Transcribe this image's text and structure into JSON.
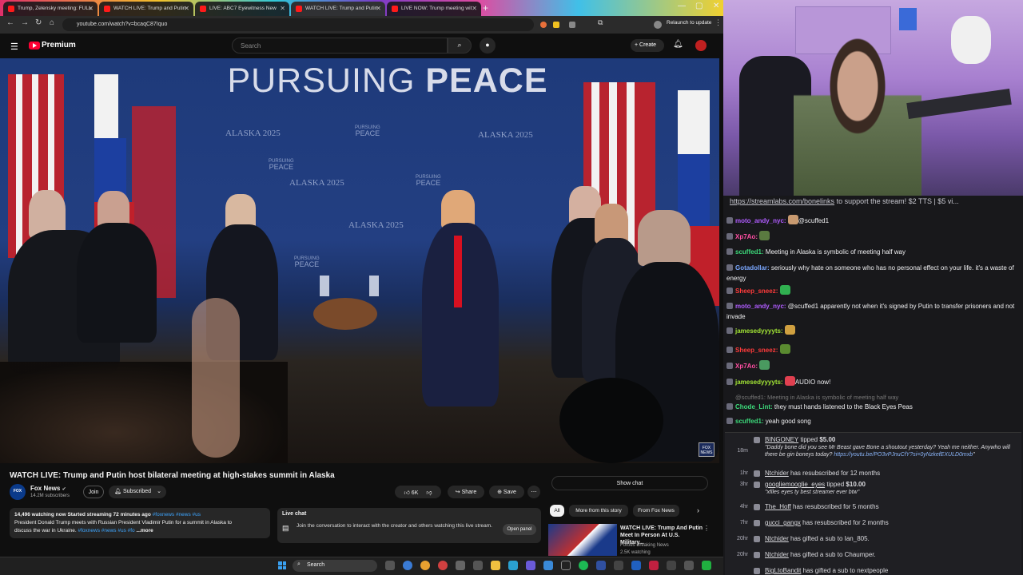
{
  "browser": {
    "tabs": [
      "Trump, Zelensky meeting: FULL",
      "WATCH LIVE: Trump and Putin",
      "LIVE: ABC7 Eyewitness New",
      "WATCH LIVE: Trump and Putin",
      "LIVE NOW: Trump meeting wit"
    ],
    "url": "youtube.com/watch?v=bcaqC87Iquo",
    "relaunch": "Relaunch to update"
  },
  "yt": {
    "logo": "Premium",
    "search_placeholder": "Search",
    "create": "Create"
  },
  "video": {
    "banner_light": "PURSUING ",
    "banner_bold": "PEACE",
    "back_text": "ALASKA 2025",
    "back_pursuing": "PURSUING",
    "back_peace": "PEACE",
    "bug": "FOX NEWS"
  },
  "info": {
    "title": "WATCH LIVE: Trump and Putin host bilateral meeting at high-stakes summit in Alaska",
    "channel": "Fox News",
    "subscribers": "14.2M subscribers",
    "join": "Join",
    "subscribed": "Subscribed",
    "likes": "6K",
    "share": "Share",
    "save": "Save",
    "desc_stats": "14,496 watching now  Started streaming 72 minutes ago",
    "desc_stat_tags": "#foxnews #news #us",
    "desc_line2": "President Donald Trump meets with Russian President Vladimir Putin for a summit in Alaska to",
    "desc_line3": "discuss the war in Ukraine.",
    "desc_line3_tags": "#foxnews #news #us #fo",
    "more": "...more",
    "live_chat_label": "Live chat",
    "live_chat_msg": "Join the conversation to interact with the creator and others watching this live stream.",
    "open_panel": "Open panel",
    "show_chat": "Show chat",
    "chips": [
      "All",
      "More from this story",
      "From Fox News"
    ],
    "rec_title": "WATCH LIVE: Trump And Putin Meet In Person At U.S. Military...",
    "rec_channel": "Forbes Breaking News",
    "rec_views": "2.5K watching"
  },
  "taskbar": {
    "search": "Search"
  },
  "stream_chat": {
    "pinned_link": "https://streamlabs.com/bonelinks",
    "pinned_rest": " to support the stream! $2 TTS | $5 vi...",
    "messages": [
      {
        "user": "moto_andy_nyc:",
        "color": "#b05cff",
        "text": "@scuffed1"
      },
      {
        "user": "Xp7Ao:",
        "color": "#ff4fa3",
        "text": ""
      },
      {
        "user": "scuffed1:",
        "color": "#3cd97a",
        "text": "Meeting in Alaska is symbolic of meeting half way"
      },
      {
        "user": "Gotadollar:",
        "color": "#7aa7ff",
        "text": "seriously why hate on someone who has no personal effect on your life. it's a waste of energy"
      },
      {
        "user": "Sheep_sneez:",
        "color": "#ff3b3b",
        "text": ""
      },
      {
        "user": "moto_andy_nyc:",
        "color": "#b05cff",
        "text": "@scuffed1 apparently not when it's signed by Putin to transfer prisoners and not invade"
      },
      {
        "user": "jamesedyyyyts:",
        "color": "#a3e635",
        "text": ""
      },
      {
        "user": "Sheep_sneez:",
        "color": "#ff3b3b",
        "text": ""
      },
      {
        "user": "Xp7Ao:",
        "color": "#ff4fa3",
        "text": ""
      },
      {
        "user": "jamesedyyyyts:",
        "color": "#a3e635",
        "text": "AUDIO now!"
      },
      {
        "user": "",
        "color": "#777",
        "text": "@scuffed1: Meeting in Alaska is symbolic of meeting half way"
      },
      {
        "user": "Chode_Lint:",
        "color": "#3cd97a",
        "text": "they must hands listened to the Black Eyes Peas"
      },
      {
        "user": "scuffed1:",
        "color": "#3cd97a",
        "text": "yeah good song"
      }
    ],
    "events": [
      {
        "time": "18m",
        "name": "BINGONEY",
        "action": " tipped ",
        "amount": "$5.00",
        "quote": "\"Daddy bone did you see Mr Beast gave Bone a shoutout yesterday? Yeah me neither. Anywho will there be gin boneys today? ",
        "link": "https://youtu.be/PO3vPJnuCfY?si=0yNzkefEXULD0mxb",
        "end": "\""
      },
      {
        "time": "1hr",
        "name": "Ntchider",
        "text": " has resubscribed for 12 months"
      },
      {
        "time": "3hr",
        "name": "googliemooglie_eyes",
        "action": " tipped ",
        "amount": "$10.00",
        "quote": "\"xfiles eyes ty best streamer ever btw\""
      },
      {
        "time": "4hr",
        "name": "The_Hoff",
        "text": " has resubscribed for 5 months"
      },
      {
        "time": "7hr",
        "name": "gucci_gangx",
        "text": " has resubscribed for 2 months"
      },
      {
        "time": "20hr",
        "name": "Ntchider",
        "text": " has gifted a sub to Ian_805."
      },
      {
        "time": "20hr",
        "name": "Ntchider",
        "text": " has gifted a sub to Chaumper."
      },
      {
        "time": "",
        "name": "BigLtoBandit",
        "text": " has gifted a sub to nextpeople"
      }
    ]
  },
  "colors": {
    "yt_red": "#ff0033",
    "link": "#3ea6ff",
    "chat_bg": "#18181b"
  }
}
